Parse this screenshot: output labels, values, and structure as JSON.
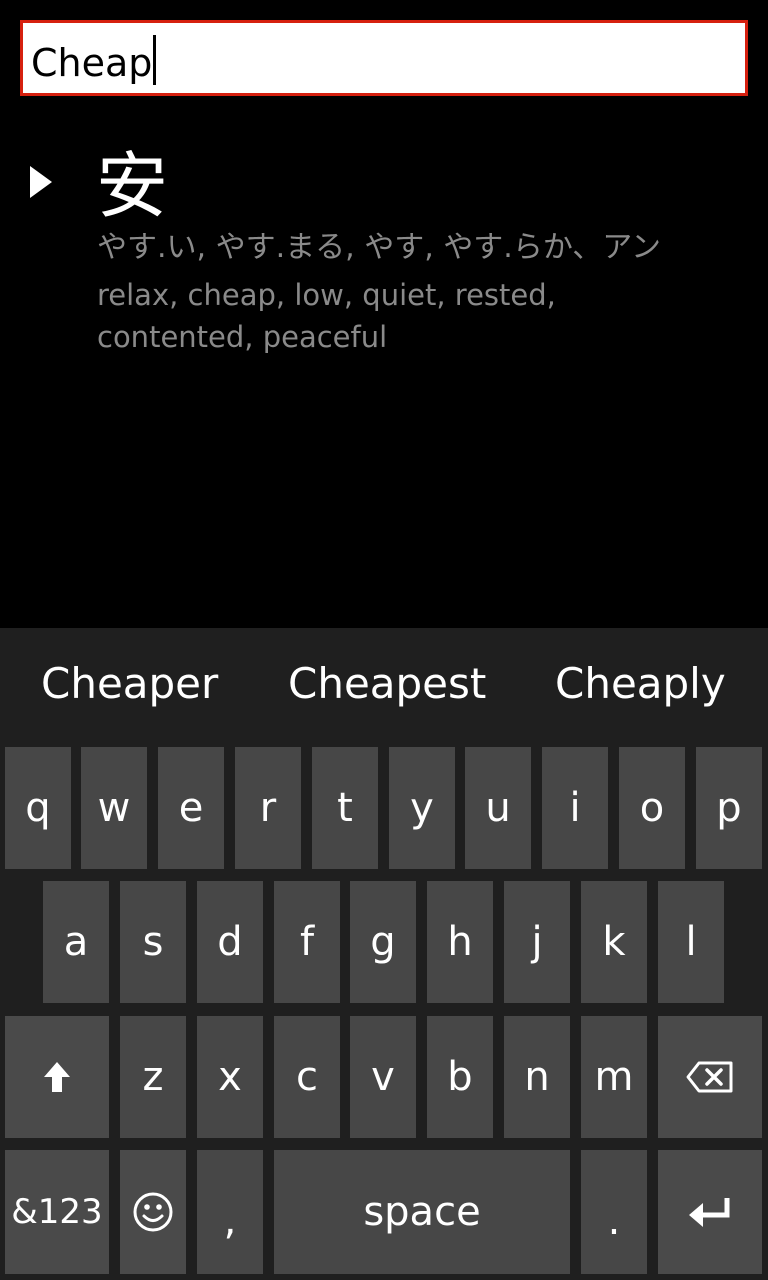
{
  "search": {
    "value": "Cheap"
  },
  "result": {
    "kanji": "安",
    "readings": "やす.い, やす.まる, やす, やす.らか、アン",
    "meanings": "relax, cheap, low, quiet, rested, contented, peaceful"
  },
  "suggestions": [
    "Cheaper",
    "Cheapest",
    "Cheaply"
  ],
  "keyboard": {
    "row1": [
      "q",
      "w",
      "e",
      "r",
      "t",
      "y",
      "u",
      "i",
      "o",
      "p"
    ],
    "row2": [
      "a",
      "s",
      "d",
      "f",
      "g",
      "h",
      "j",
      "k",
      "l"
    ],
    "row3": [
      "z",
      "x",
      "c",
      "v",
      "b",
      "n",
      "m"
    ],
    "symbols_label": "&123",
    "comma": ",",
    "space_label": "space",
    "period": ".",
    "icons": {
      "shift": "shift-icon",
      "backspace": "backspace-icon",
      "emoji": "emoji-icon",
      "enter": "enter-icon"
    }
  },
  "colors": {
    "accent_border": "#d6200f",
    "secondary_text": "#8a8a8a",
    "key_bg": "#474747",
    "keyboard_bg": "#1f1f1f"
  }
}
